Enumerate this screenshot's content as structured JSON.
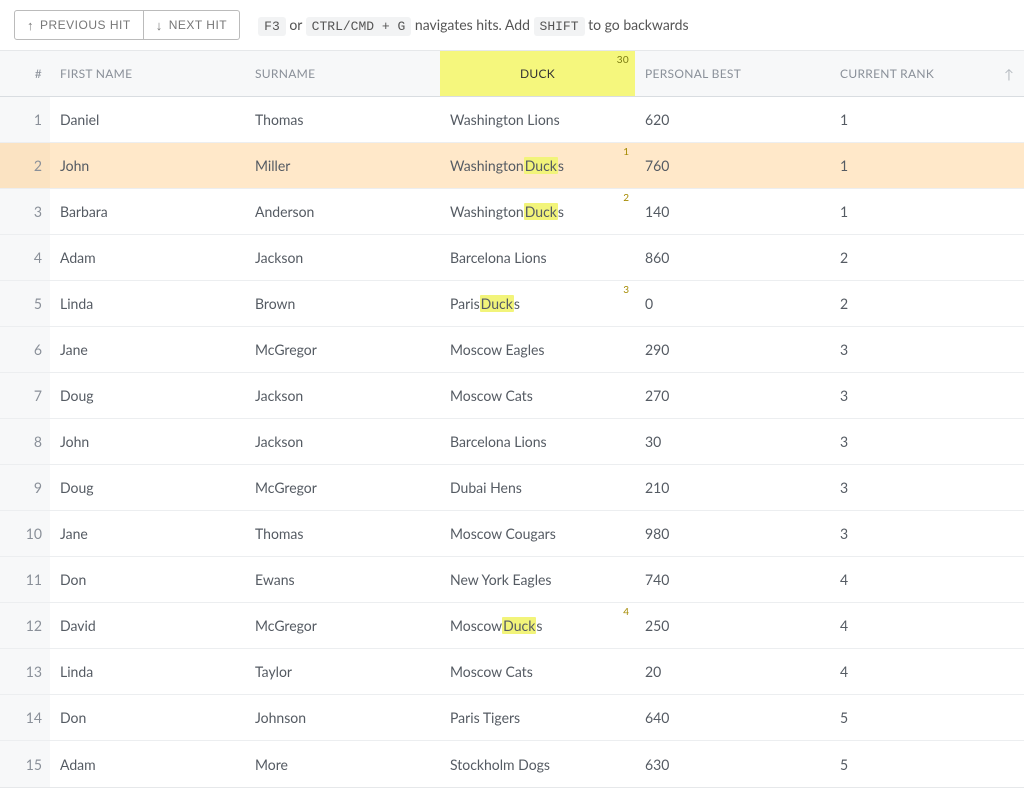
{
  "toolbar": {
    "prev_label": "PREVIOUS HIT",
    "next_label": "NEXT HIT",
    "hint_k1": "F3",
    "hint_t1": " or ",
    "hint_k2": "CTRL/CMD + G",
    "hint_t2": " navigates hits. Add ",
    "hint_k3": "SHIFT",
    "hint_t3": " to go backwards"
  },
  "columns": {
    "num": "#",
    "first": "FIRST NAME",
    "surname": "SURNAME",
    "team_search": "DUCK",
    "team_count": "30",
    "best": "PERSONAL BEST",
    "rank": "CURRENT RANK"
  },
  "rows": [
    {
      "n": "1",
      "first": "Daniel",
      "surname": "Thomas",
      "team_pre": "Washington Lions",
      "team_hit": "",
      "team_post": "",
      "hit": "",
      "best": "620",
      "rank": "1",
      "hl": false
    },
    {
      "n": "2",
      "first": "John",
      "surname": "Miller",
      "team_pre": "Washington ",
      "team_hit": "Duck",
      "team_post": "s",
      "hit": "1",
      "best": "760",
      "rank": "1",
      "hl": true
    },
    {
      "n": "3",
      "first": "Barbara",
      "surname": "Anderson",
      "team_pre": "Washington ",
      "team_hit": "Duck",
      "team_post": "s",
      "hit": "2",
      "best": "140",
      "rank": "1",
      "hl": false
    },
    {
      "n": "4",
      "first": "Adam",
      "surname": "Jackson",
      "team_pre": "Barcelona Lions",
      "team_hit": "",
      "team_post": "",
      "hit": "",
      "best": "860",
      "rank": "2",
      "hl": false
    },
    {
      "n": "5",
      "first": "Linda",
      "surname": "Brown",
      "team_pre": "Paris ",
      "team_hit": "Duck",
      "team_post": "s",
      "hit": "3",
      "best": "0",
      "rank": "2",
      "hl": false
    },
    {
      "n": "6",
      "first": "Jane",
      "surname": "McGregor",
      "team_pre": "Moscow Eagles",
      "team_hit": "",
      "team_post": "",
      "hit": "",
      "best": "290",
      "rank": "3",
      "hl": false
    },
    {
      "n": "7",
      "first": "Doug",
      "surname": "Jackson",
      "team_pre": "Moscow Cats",
      "team_hit": "",
      "team_post": "",
      "hit": "",
      "best": "270",
      "rank": "3",
      "hl": false
    },
    {
      "n": "8",
      "first": "John",
      "surname": "Jackson",
      "team_pre": "Barcelona Lions",
      "team_hit": "",
      "team_post": "",
      "hit": "",
      "best": "30",
      "rank": "3",
      "hl": false
    },
    {
      "n": "9",
      "first": "Doug",
      "surname": "McGregor",
      "team_pre": "Dubai Hens",
      "team_hit": "",
      "team_post": "",
      "hit": "",
      "best": "210",
      "rank": "3",
      "hl": false
    },
    {
      "n": "10",
      "first": "Jane",
      "surname": "Thomas",
      "team_pre": "Moscow Cougars",
      "team_hit": "",
      "team_post": "",
      "hit": "",
      "best": "980",
      "rank": "3",
      "hl": false
    },
    {
      "n": "11",
      "first": "Don",
      "surname": "Ewans",
      "team_pre": "New York Eagles",
      "team_hit": "",
      "team_post": "",
      "hit": "",
      "best": "740",
      "rank": "4",
      "hl": false
    },
    {
      "n": "12",
      "first": "David",
      "surname": "McGregor",
      "team_pre": "Moscow ",
      "team_hit": "Duck",
      "team_post": "s",
      "hit": "4",
      "best": "250",
      "rank": "4",
      "hl": false
    },
    {
      "n": "13",
      "first": "Linda",
      "surname": "Taylor",
      "team_pre": "Moscow Cats",
      "team_hit": "",
      "team_post": "",
      "hit": "",
      "best": "20",
      "rank": "4",
      "hl": false
    },
    {
      "n": "14",
      "first": "Don",
      "surname": "Johnson",
      "team_pre": "Paris Tigers",
      "team_hit": "",
      "team_post": "",
      "hit": "",
      "best": "640",
      "rank": "5",
      "hl": false
    },
    {
      "n": "15",
      "first": "Adam",
      "surname": "More",
      "team_pre": "Stockholm Dogs",
      "team_hit": "",
      "team_post": "",
      "hit": "",
      "best": "630",
      "rank": "5",
      "hl": false
    }
  ]
}
